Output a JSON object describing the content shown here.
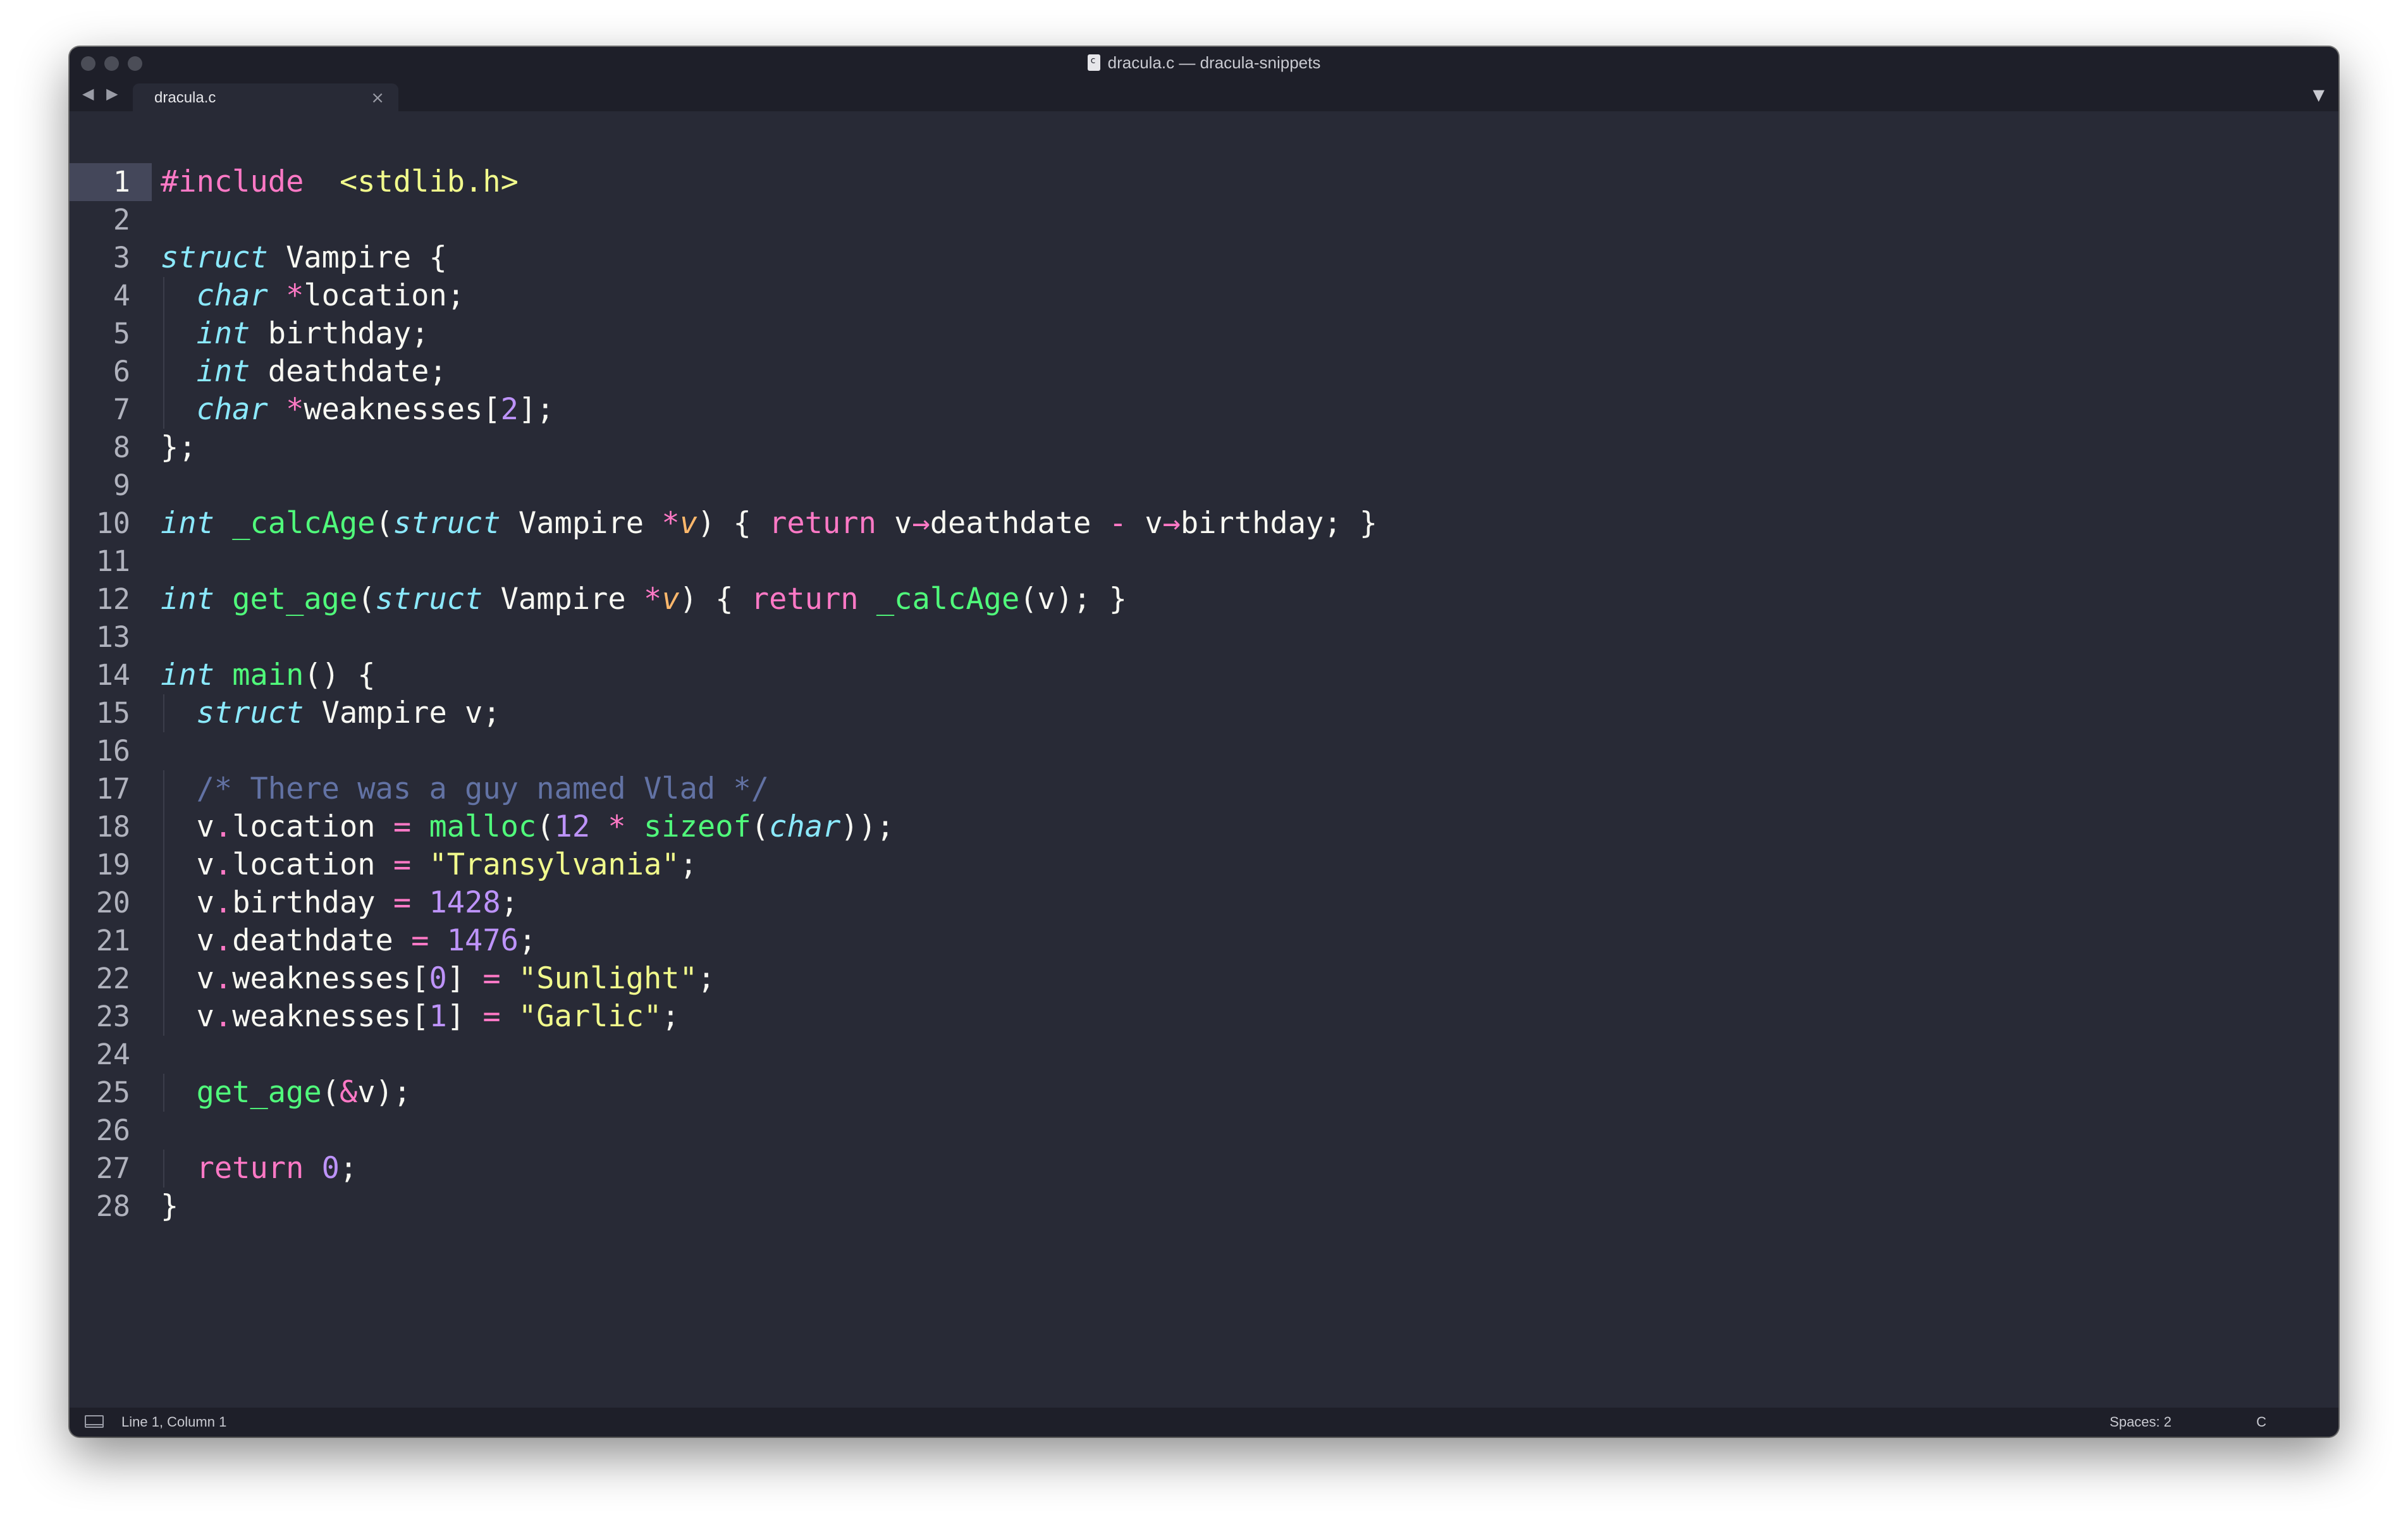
{
  "window": {
    "title": "dracula.c — dracula-snippets"
  },
  "tabbar": {
    "nav_arrows": "◀ ▶",
    "tab_label": "dracula.c",
    "close_glyph": "×",
    "dropdown_glyph": "▼"
  },
  "editor": {
    "current_line": 1,
    "lines": [
      [
        [
          "kw",
          "#include"
        ],
        [
          "",
          "  "
        ],
        [
          "str",
          "<stdlib.h>"
        ]
      ],
      [],
      [
        [
          "typ",
          "struct"
        ],
        [
          "",
          " Vampire {"
        ]
      ],
      [
        [
          "",
          ""
        ],
        [
          "typ",
          "char"
        ],
        [
          "",
          " "
        ],
        [
          "op",
          "*"
        ],
        [
          "",
          "location;"
        ]
      ],
      [
        [
          "",
          ""
        ],
        [
          "typ",
          "int"
        ],
        [
          "",
          " birthday;"
        ]
      ],
      [
        [
          "",
          ""
        ],
        [
          "typ",
          "int"
        ],
        [
          "",
          " deathdate;"
        ]
      ],
      [
        [
          "",
          ""
        ],
        [
          "typ",
          "char"
        ],
        [
          "",
          " "
        ],
        [
          "op",
          "*"
        ],
        [
          "",
          "weaknesses["
        ],
        [
          "num",
          "2"
        ],
        [
          "",
          "];"
        ]
      ],
      [
        [
          "",
          "};"
        ]
      ],
      [],
      [
        [
          "typ",
          "int"
        ],
        [
          "",
          " "
        ],
        [
          "fn",
          "_calcAge"
        ],
        [
          "",
          "("
        ],
        [
          "typ",
          "struct"
        ],
        [
          "",
          " Vampire "
        ],
        [
          "op",
          "*"
        ],
        [
          "par",
          "v"
        ],
        [
          "",
          ") { "
        ],
        [
          "kw",
          "return"
        ],
        [
          "",
          " v"
        ],
        [
          "op",
          "→"
        ],
        [
          "",
          "deathdate "
        ],
        [
          "op",
          "-"
        ],
        [
          "",
          " v"
        ],
        [
          "op",
          "→"
        ],
        [
          "",
          "birthday; }"
        ]
      ],
      [],
      [
        [
          "typ",
          "int"
        ],
        [
          "",
          " "
        ],
        [
          "fn",
          "get_age"
        ],
        [
          "",
          "("
        ],
        [
          "typ",
          "struct"
        ],
        [
          "",
          " Vampire "
        ],
        [
          "op",
          "*"
        ],
        [
          "par",
          "v"
        ],
        [
          "",
          ") { "
        ],
        [
          "kw",
          "return"
        ],
        [
          "",
          " "
        ],
        [
          "fn",
          "_calcAge"
        ],
        [
          "",
          "(v); }"
        ]
      ],
      [],
      [
        [
          "typ",
          "int"
        ],
        [
          "",
          " "
        ],
        [
          "fn",
          "main"
        ],
        [
          "",
          "() {"
        ]
      ],
      [
        [
          "",
          ""
        ],
        [
          "typ",
          "struct"
        ],
        [
          "",
          " Vampire v;"
        ]
      ],
      [],
      [
        [
          "",
          ""
        ],
        [
          "com",
          "/* There was a guy named Vlad */"
        ]
      ],
      [
        [
          "",
          "",
          "v"
        ],
        [
          "op",
          "."
        ],
        [
          "",
          "location "
        ],
        [
          "op",
          "="
        ],
        [
          "",
          " "
        ],
        [
          "fn",
          "malloc"
        ],
        [
          "",
          "("
        ],
        [
          "num",
          "12"
        ],
        [
          "",
          " "
        ],
        [
          "op",
          "*"
        ],
        [
          "",
          " "
        ],
        [
          "fn",
          "sizeof"
        ],
        [
          "",
          "("
        ],
        [
          "typ",
          "char"
        ],
        [
          "",
          "));"
        ]
      ],
      [
        [
          "",
          "",
          "v"
        ],
        [
          "op",
          "."
        ],
        [
          "",
          "location "
        ],
        [
          "op",
          "="
        ],
        [
          "",
          " "
        ],
        [
          "str",
          "\"Transylvania\""
        ],
        [
          "",
          ";"
        ]
      ],
      [
        [
          "",
          "",
          "v"
        ],
        [
          "op",
          "."
        ],
        [
          "",
          "birthday "
        ],
        [
          "op",
          "="
        ],
        [
          "",
          " "
        ],
        [
          "num",
          "1428"
        ],
        [
          "",
          ";"
        ]
      ],
      [
        [
          "",
          "",
          "v"
        ],
        [
          "op",
          "."
        ],
        [
          "",
          "deathdate "
        ],
        [
          "op",
          "="
        ],
        [
          "",
          " "
        ],
        [
          "num",
          "1476"
        ],
        [
          "",
          ";"
        ]
      ],
      [
        [
          "",
          "",
          "v"
        ],
        [
          "op",
          "."
        ],
        [
          "",
          "weaknesses["
        ],
        [
          "num",
          "0"
        ],
        [
          "",
          "] "
        ],
        [
          "op",
          "="
        ],
        [
          "",
          " "
        ],
        [
          "str",
          "\"Sunlight\""
        ],
        [
          "",
          ";"
        ]
      ],
      [
        [
          "",
          "",
          "v"
        ],
        [
          "op",
          "."
        ],
        [
          "",
          "weaknesses["
        ],
        [
          "num",
          "1"
        ],
        [
          "",
          "] "
        ],
        [
          "op",
          "="
        ],
        [
          "",
          " "
        ],
        [
          "str",
          "\"Garlic\""
        ],
        [
          "",
          ";"
        ]
      ],
      [],
      [
        [
          "",
          ""
        ],
        [
          "fn",
          "get_age"
        ],
        [
          "",
          "("
        ],
        [
          "op",
          "&"
        ],
        [
          "",
          "v);"
        ]
      ],
      [],
      [
        [
          "",
          ""
        ],
        [
          "kw",
          "return"
        ],
        [
          "",
          " "
        ],
        [
          "num",
          "0"
        ],
        [
          "",
          ";"
        ]
      ],
      [
        [
          "",
          "}"
        ]
      ]
    ]
  },
  "statusbar": {
    "position": "Line 1, Column 1",
    "spaces": "Spaces: 2",
    "syntax": "C"
  },
  "theme": {
    "background": "#282a36",
    "chrome": "#1e1f29",
    "pink": "#ff79c6",
    "cyan": "#8be9fd",
    "green": "#50fa7b",
    "yellow": "#f1fa8c",
    "purple": "#bd93f9",
    "comment": "#6272a4",
    "orange": "#ffb86c"
  }
}
